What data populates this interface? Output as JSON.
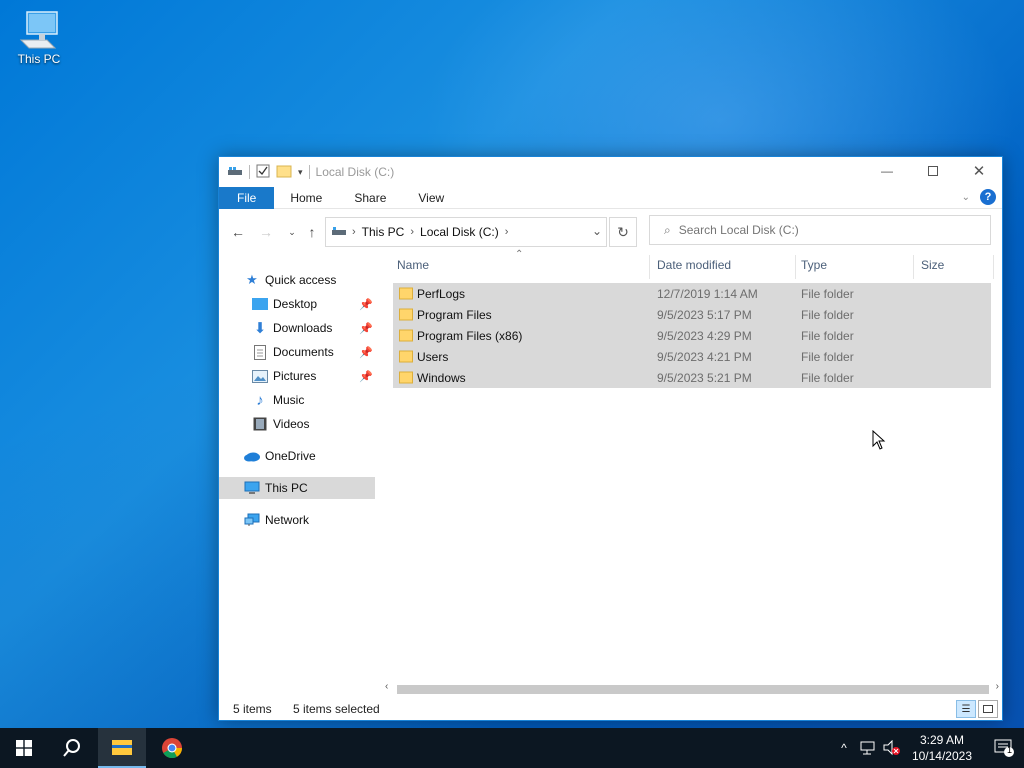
{
  "desktop": {
    "icons": [
      {
        "label": "This PC",
        "icon": "computer-icon"
      }
    ]
  },
  "window": {
    "title": "Local Disk (C:)",
    "ribbon_tabs": [
      "File",
      "Home",
      "Share",
      "View"
    ],
    "address": {
      "crumbs": [
        "This PC",
        "Local Disk (C:)"
      ]
    },
    "search": {
      "placeholder": "Search Local Disk (C:)"
    },
    "nav": {
      "quick_access": "Quick access",
      "items": [
        {
          "label": "Desktop",
          "icon": "desktop-folder-icon",
          "pinned": true
        },
        {
          "label": "Downloads",
          "icon": "download-arrow-icon",
          "pinned": true
        },
        {
          "label": "Documents",
          "icon": "documents-icon",
          "pinned": true
        },
        {
          "label": "Pictures",
          "icon": "pictures-icon",
          "pinned": true
        },
        {
          "label": "Music",
          "icon": "music-note-icon",
          "pinned": false
        },
        {
          "label": "Videos",
          "icon": "video-film-icon",
          "pinned": false
        }
      ],
      "onedrive": "OneDrive",
      "this_pc": "This PC",
      "network": "Network"
    },
    "columns": [
      "Name",
      "Date modified",
      "Type",
      "Size"
    ],
    "files": [
      {
        "name": "PerfLogs",
        "date": "12/7/2019 1:14 AM",
        "type": "File folder"
      },
      {
        "name": "Program Files",
        "date": "9/5/2023 5:17 PM",
        "type": "File folder"
      },
      {
        "name": "Program Files (x86)",
        "date": "9/5/2023 4:29 PM",
        "type": "File folder"
      },
      {
        "name": "Users",
        "date": "9/5/2023 4:21 PM",
        "type": "File folder"
      },
      {
        "name": "Windows",
        "date": "9/5/2023 5:21 PM",
        "type": "File folder"
      }
    ],
    "status": {
      "count": "5 items",
      "selected": "5 items selected"
    }
  },
  "taskbar": {
    "time": "3:29 AM",
    "date": "10/14/2023",
    "notification_count": "1"
  },
  "colors": {
    "accent": "#1979ca",
    "selection": "#d9d9d9",
    "taskbar": "#0c1722"
  }
}
